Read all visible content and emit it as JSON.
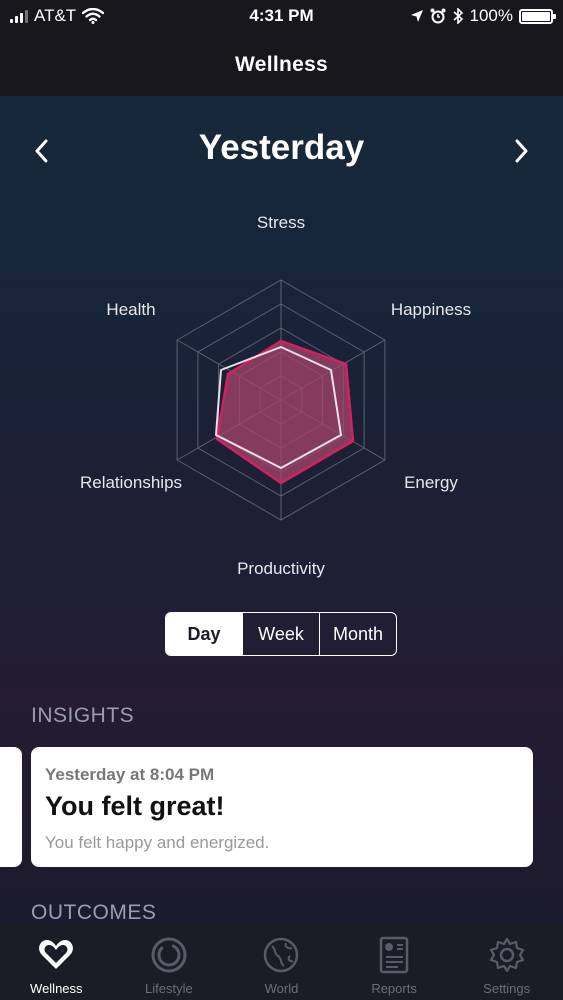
{
  "status": {
    "carrier": "AT&T",
    "time": "4:31 PM",
    "battery": "100%"
  },
  "nav": {
    "title": "Wellness"
  },
  "date": {
    "title": "Yesterday"
  },
  "radar": {
    "axes": [
      "Stress",
      "Happiness",
      "Energy",
      "Productivity",
      "Relationships",
      "Health"
    ],
    "colors": {
      "outline_light": "#f0e9f0",
      "outline_accent": "#d2215e",
      "fill": "#a34369"
    }
  },
  "segments": [
    "Day",
    "Week",
    "Month"
  ],
  "segment_active": "Day",
  "insights": {
    "label": "INSIGHTS",
    "card": {
      "time": "Yesterday at 8:04 PM",
      "headline": "You felt great!",
      "detail": "You felt happy and energized."
    }
  },
  "outcomes": {
    "label": "OUTCOMES"
  },
  "tabs": [
    {
      "label": "Wellness",
      "icon": "heart-icon"
    },
    {
      "label": "Lifestyle",
      "icon": "ring-icon"
    },
    {
      "label": "World",
      "icon": "globe-icon"
    },
    {
      "label": "Reports",
      "icon": "report-icon"
    },
    {
      "label": "Settings",
      "icon": "gear-icon"
    }
  ]
}
